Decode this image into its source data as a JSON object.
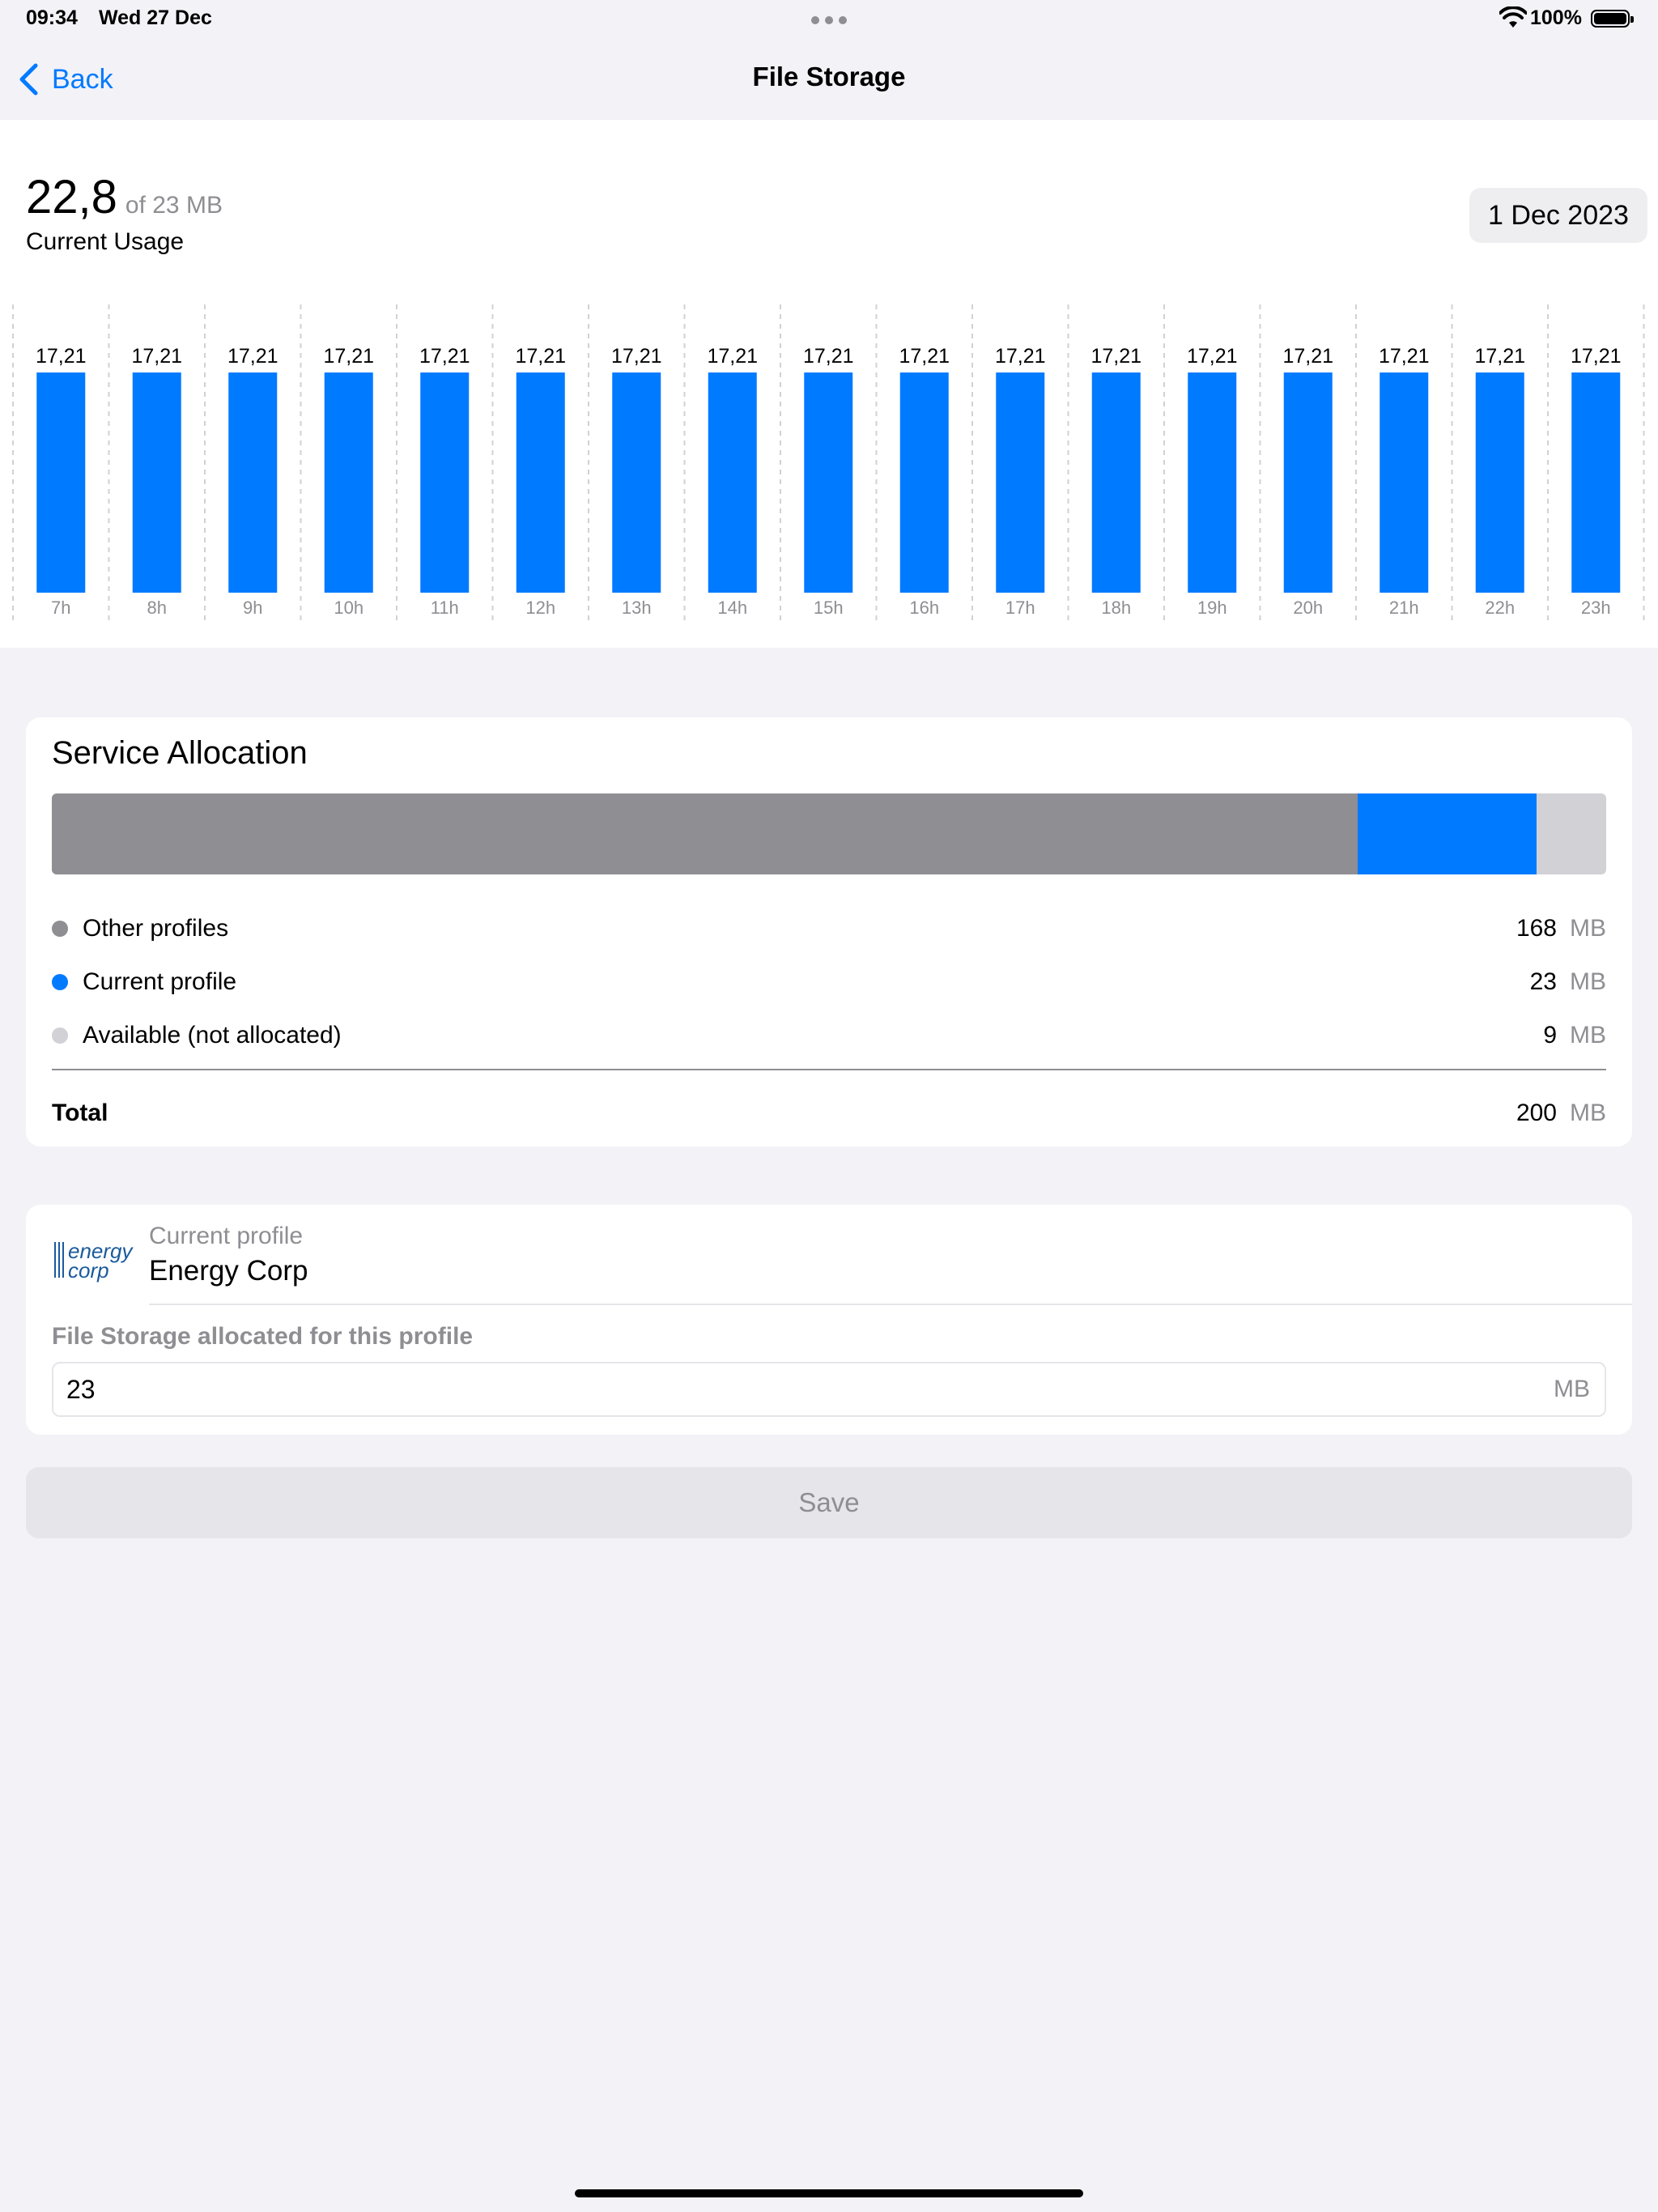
{
  "status": {
    "time": "09:34",
    "date": "Wed 27 Dec",
    "battery": "100%"
  },
  "nav": {
    "back_label": "Back",
    "title": "File Storage"
  },
  "usage": {
    "value": "22,8",
    "of_label": "of 23 MB",
    "label": "Current Usage",
    "date_button": "1 Dec 2023"
  },
  "chart_data": {
    "type": "bar",
    "categories": [
      "7h",
      "8h",
      "9h",
      "10h",
      "11h",
      "12h",
      "13h",
      "14h",
      "15h",
      "16h",
      "17h",
      "18h",
      "19h",
      "20h",
      "21h",
      "22h",
      "23h"
    ],
    "values": [
      17.21,
      17.21,
      17.21,
      17.21,
      17.21,
      17.21,
      17.21,
      17.21,
      17.21,
      17.21,
      17.21,
      17.21,
      17.21,
      17.21,
      17.21,
      17.21,
      17.21
    ],
    "value_labels": [
      "17,21",
      "17,21",
      "17,21",
      "17,21",
      "17,21",
      "17,21",
      "17,21",
      "17,21",
      "17,21",
      "17,21",
      "17,21",
      "17,21",
      "17,21",
      "17,21",
      "17,21",
      "17,21",
      "17,21"
    ],
    "color": "#007aff",
    "ylim": [
      0,
      20
    ],
    "grid": true
  },
  "allocation": {
    "title": "Service Allocation",
    "segments": [
      {
        "label": "Other profiles",
        "value": "168",
        "unit": "MB",
        "mb": 168,
        "color": "#8e8e93"
      },
      {
        "label": "Current profile",
        "value": "23",
        "unit": "MB",
        "mb": 23,
        "color": "#007aff"
      },
      {
        "label": "Available (not allocated)",
        "value": "9",
        "unit": "MB",
        "mb": 9,
        "color": "#d1d1d6"
      }
    ],
    "total_label": "Total",
    "total_value": "200",
    "total_unit": "MB"
  },
  "profile": {
    "sub_label": "Current profile",
    "name": "Energy Corp",
    "logo_text_1": "energy",
    "logo_text_2": "corp",
    "field_label": "File Storage allocated for this profile",
    "field_value": "23",
    "field_unit": "MB"
  },
  "save_label": "Save"
}
